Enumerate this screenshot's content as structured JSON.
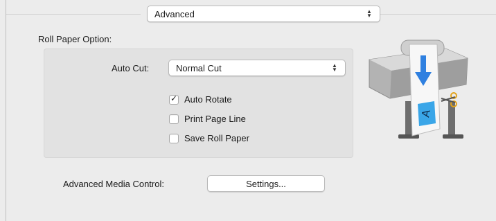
{
  "preset_popup": {
    "value": "Advanced"
  },
  "roll_paper": {
    "heading": "Roll Paper Option:",
    "auto_cut": {
      "label": "Auto Cut:",
      "value": "Normal Cut"
    },
    "checkboxes": [
      {
        "label": "Auto Rotate",
        "checked": true
      },
      {
        "label": "Print Page Line",
        "checked": false
      },
      {
        "label": "Save Roll Paper",
        "checked": false
      }
    ]
  },
  "media_control": {
    "label": "Advanced Media Control:",
    "button_label": "Settings..."
  },
  "illustration": {
    "icon": "large-format-printer-icon",
    "page_letter": "A"
  },
  "colors": {
    "accent_blue": "#2f80e0",
    "page_blue": "#3aa6e8"
  }
}
